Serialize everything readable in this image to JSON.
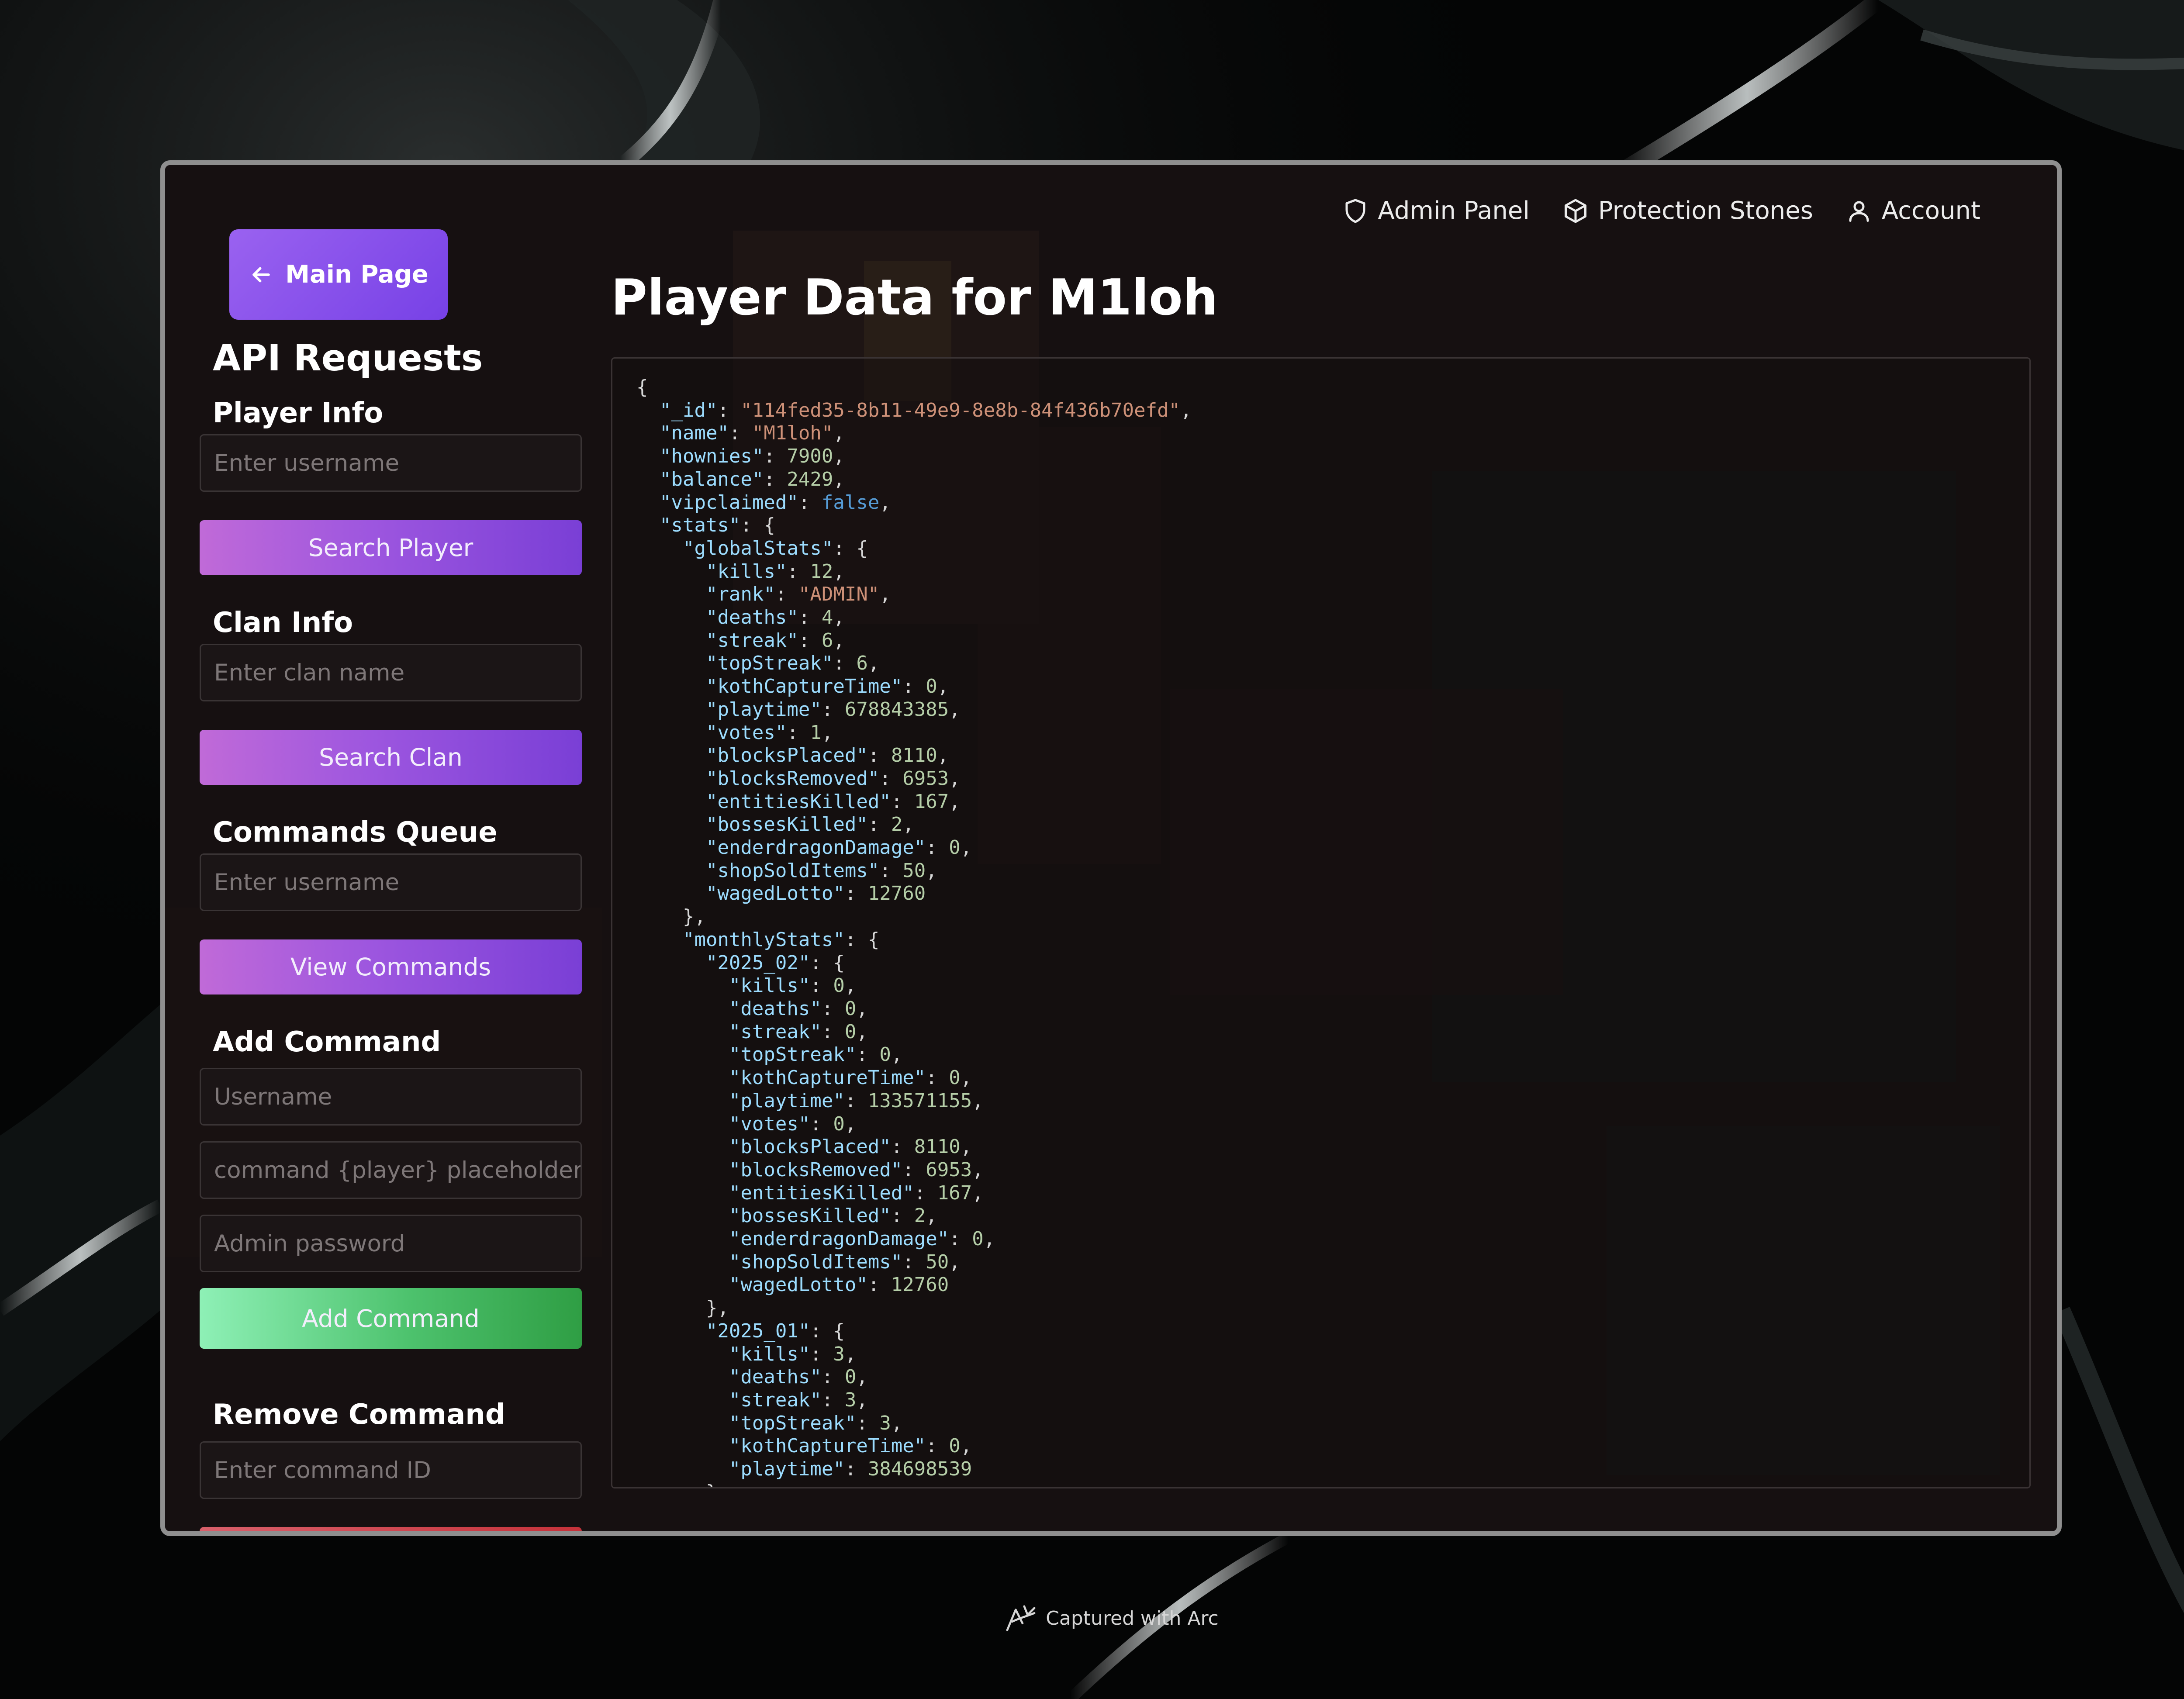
{
  "nav": {
    "admin_panel": "Admin Panel",
    "protection_stones": "Protection Stones",
    "account": "Account"
  },
  "sidebar": {
    "main_page": "Main Page",
    "heading": "API Requests",
    "player_info": {
      "title": "Player Info",
      "placeholder": "Enter username",
      "button": "Search Player"
    },
    "clan_info": {
      "title": "Clan Info",
      "placeholder": "Enter clan name",
      "button": "Search Clan"
    },
    "commands_queue": {
      "title": "Commands Queue",
      "placeholder": "Enter username",
      "button": "View Commands"
    },
    "add_command": {
      "title": "Add Command",
      "username_placeholder": "Username",
      "command_placeholder": "command {player} placeholder",
      "password_placeholder": "Admin password",
      "button": "Add Command"
    },
    "remove_command": {
      "title": "Remove Command",
      "placeholder": "Enter command ID"
    }
  },
  "main": {
    "title": "Player Data for M1loh"
  },
  "player_json": {
    "_id": "114fed35-8b11-49e9-8e8b-84f436b70efd",
    "name": "M1loh",
    "hownies": 7900,
    "balance": 2429,
    "vipclaimed": false,
    "stats": {
      "globalStats": {
        "kills": 12,
        "rank": "ADMIN",
        "deaths": 4,
        "streak": 6,
        "topStreak": 6,
        "kothCaptureTime": 0,
        "playtime": 678843385,
        "votes": 1,
        "blocksPlaced": 8110,
        "blocksRemoved": 6953,
        "entitiesKilled": 167,
        "bossesKilled": 2,
        "enderdragonDamage": 0,
        "shopSoldItems": 50,
        "wagedLotto": 12760
      },
      "monthlyStats": {
        "2025_02": {
          "kills": 0,
          "deaths": 0,
          "streak": 0,
          "topStreak": 0,
          "kothCaptureTime": 0,
          "playtime": 133571155,
          "votes": 0,
          "blocksPlaced": 8110,
          "blocksRemoved": 6953,
          "entitiesKilled": 167,
          "bossesKilled": 2,
          "enderdragonDamage": 0,
          "shopSoldItems": 50,
          "wagedLotto": 12760
        },
        "2025_01": {
          "kills": 3,
          "deaths": 0,
          "streak": 3,
          "topStreak": 3,
          "kothCaptureTime": 0,
          "playtime": 384698539
        }
      }
    }
  },
  "footer": {
    "text": "Captured with Arc"
  },
  "icons": {
    "admin": "shield-icon",
    "protection": "cube-icon",
    "account": "user-icon",
    "back": "arrow-left-icon",
    "arc": "arc-logo-icon"
  },
  "colors": {
    "accent_purple": "#8b52e8",
    "accent_green": "#3cb55a",
    "accent_red": "#cf3e47",
    "json_key": "#9cdcfe",
    "json_string": "#ce9178",
    "json_number": "#b5cea8",
    "json_bool": "#569cd6"
  }
}
